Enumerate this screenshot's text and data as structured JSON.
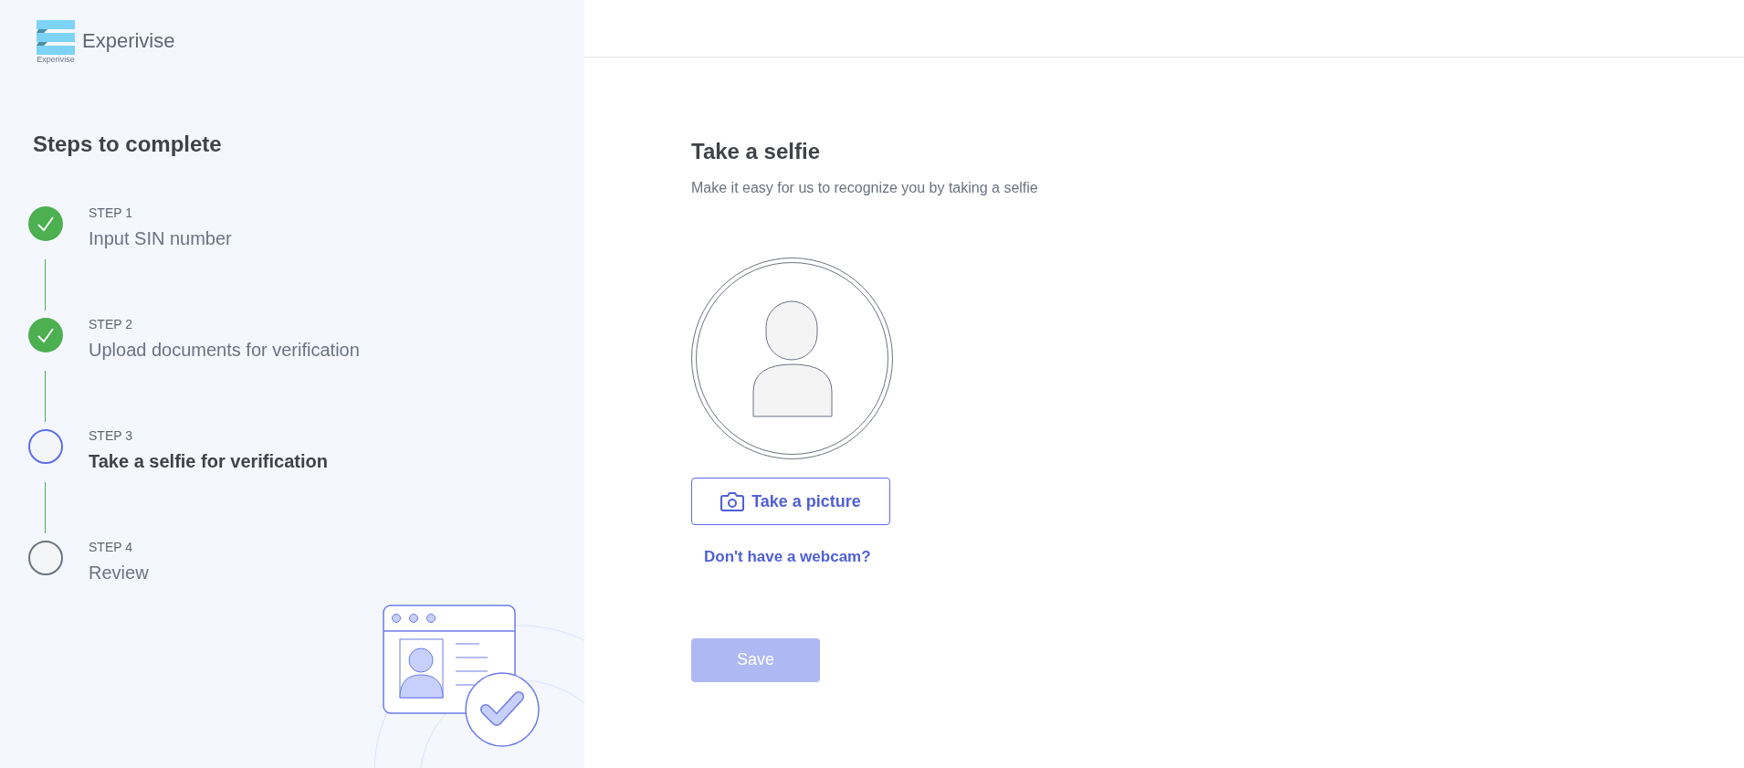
{
  "brand": {
    "name": "Experivise",
    "logo_caption": "Experivise"
  },
  "sidebar": {
    "title": "Steps to complete",
    "steps": [
      {
        "label": "STEP 1",
        "title": "Input SIN number",
        "kind": "done"
      },
      {
        "label": "STEP 2",
        "title": "Upload documents for verification",
        "kind": "done"
      },
      {
        "label": "STEP 3",
        "title": "Take a selfie for verification",
        "kind": "current"
      },
      {
        "label": "STEP 4",
        "title": "Review",
        "kind": "todo"
      }
    ]
  },
  "main": {
    "title": "Take a selfie",
    "subtitle": "Make it easy for us to recognize you by taking a selfie",
    "take_picture_button": "Take a picture",
    "webcam_link": "Don't have a webcam?",
    "save_button": {
      "label": "Save",
      "disabled": true
    }
  }
}
